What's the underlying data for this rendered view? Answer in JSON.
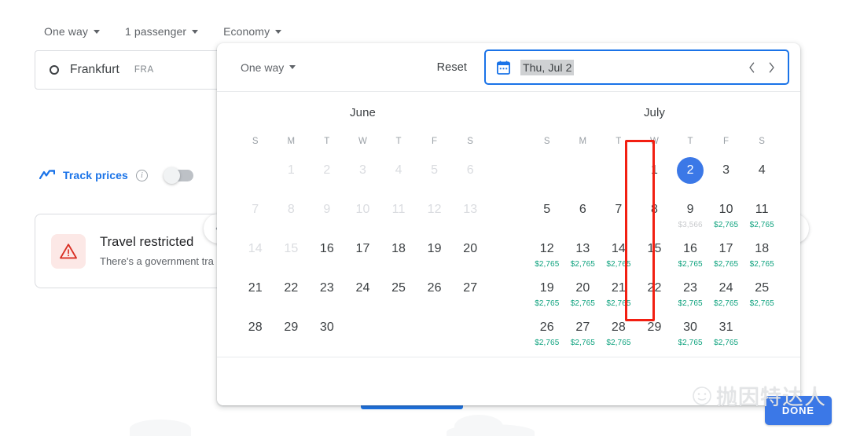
{
  "search_panel": {
    "options": [
      {
        "label": "One way",
        "icon": "chevron-down-icon"
      },
      {
        "label": "1 passenger",
        "icon": "chevron-down-icon"
      },
      {
        "label": "Economy",
        "icon": "chevron-down-icon"
      }
    ],
    "origin": {
      "city": "Frankfurt",
      "code": "FRA",
      "icon": "origin-ring-icon"
    },
    "track_prices": {
      "label": "Track prices",
      "info_icon": "info-icon",
      "toggle_state": "off"
    },
    "restriction_card": {
      "icon": "warning-triangle-icon",
      "title": "Travel restricted",
      "subtitle": "There's a government tra"
    }
  },
  "carousel": {
    "prev_icon": "chevron-left-icon",
    "next_icon": "chevron-right-icon"
  },
  "datepicker": {
    "trip_type": "One way",
    "trip_type_icon": "chevron-down-icon",
    "reset_label": "Reset",
    "date_field": {
      "icon": "calendar-icon",
      "value": "Thu, Jul 2",
      "prev_icon": "chevron-left-icon",
      "next_icon": "chevron-right-icon"
    },
    "done_label": "DONE",
    "dow": [
      "S",
      "M",
      "T",
      "W",
      "T",
      "F",
      "S"
    ],
    "months": [
      {
        "name": "June",
        "lead_blanks": 1,
        "days": [
          {
            "n": 1,
            "state": "disabled"
          },
          {
            "n": 2,
            "state": "disabled"
          },
          {
            "n": 3,
            "state": "disabled"
          },
          {
            "n": 4,
            "state": "disabled"
          },
          {
            "n": 5,
            "state": "disabled"
          },
          {
            "n": 6,
            "state": "disabled"
          },
          {
            "n": 7,
            "state": "disabled"
          },
          {
            "n": 8,
            "state": "disabled"
          },
          {
            "n": 9,
            "state": "disabled"
          },
          {
            "n": 10,
            "state": "disabled"
          },
          {
            "n": 11,
            "state": "disabled"
          },
          {
            "n": 12,
            "state": "disabled"
          },
          {
            "n": 13,
            "state": "disabled"
          },
          {
            "n": 14,
            "state": "disabled"
          },
          {
            "n": 15,
            "state": "disabled"
          },
          {
            "n": 16,
            "state": "enabled"
          },
          {
            "n": 17,
            "state": "enabled"
          },
          {
            "n": 18,
            "state": "enabled"
          },
          {
            "n": 19,
            "state": "enabled"
          },
          {
            "n": 20,
            "state": "enabled"
          },
          {
            "n": 21,
            "state": "enabled"
          },
          {
            "n": 22,
            "state": "enabled"
          },
          {
            "n": 23,
            "state": "enabled"
          },
          {
            "n": 24,
            "state": "enabled"
          },
          {
            "n": 25,
            "state": "enabled"
          },
          {
            "n": 26,
            "state": "enabled"
          },
          {
            "n": 27,
            "state": "enabled"
          },
          {
            "n": 28,
            "state": "enabled"
          },
          {
            "n": 29,
            "state": "enabled"
          },
          {
            "n": 30,
            "state": "enabled"
          }
        ]
      },
      {
        "name": "July",
        "lead_blanks": 3,
        "days": [
          {
            "n": 1,
            "state": "enabled",
            "price": ""
          },
          {
            "n": 2,
            "state": "selected",
            "price": ""
          },
          {
            "n": 3,
            "state": "enabled",
            "price": ""
          },
          {
            "n": 4,
            "state": "enabled",
            "price": ""
          },
          {
            "n": 5,
            "state": "enabled",
            "price": ""
          },
          {
            "n": 6,
            "state": "enabled",
            "price": ""
          },
          {
            "n": 7,
            "state": "enabled",
            "price": ""
          },
          {
            "n": 8,
            "state": "enabled",
            "price": ""
          },
          {
            "n": 9,
            "state": "enabled",
            "price": "$3,566",
            "price_level": "high"
          },
          {
            "n": 10,
            "state": "enabled",
            "price": "$2,765"
          },
          {
            "n": 11,
            "state": "enabled",
            "price": "$2,765"
          },
          {
            "n": 12,
            "state": "enabled",
            "price": "$2,765"
          },
          {
            "n": 13,
            "state": "enabled",
            "price": "$2,765"
          },
          {
            "n": 14,
            "state": "enabled",
            "price": "$2,765"
          },
          {
            "n": 15,
            "state": "enabled",
            "price": ""
          },
          {
            "n": 16,
            "state": "enabled",
            "price": "$2,765"
          },
          {
            "n": 17,
            "state": "enabled",
            "price": "$2,765"
          },
          {
            "n": 18,
            "state": "enabled",
            "price": "$2,765"
          },
          {
            "n": 19,
            "state": "enabled",
            "price": "$2,765"
          },
          {
            "n": 20,
            "state": "enabled",
            "price": "$2,765"
          },
          {
            "n": 21,
            "state": "enabled",
            "price": "$2,765"
          },
          {
            "n": 22,
            "state": "enabled",
            "price": ""
          },
          {
            "n": 23,
            "state": "enabled",
            "price": "$2,765"
          },
          {
            "n": 24,
            "state": "enabled",
            "price": "$2,765"
          },
          {
            "n": 25,
            "state": "enabled",
            "price": "$2,765"
          },
          {
            "n": 26,
            "state": "enabled",
            "price": "$2,765"
          },
          {
            "n": 27,
            "state": "enabled",
            "price": "$2,765"
          },
          {
            "n": 28,
            "state": "enabled",
            "price": "$2,765"
          },
          {
            "n": 29,
            "state": "enabled",
            "price": ""
          },
          {
            "n": 30,
            "state": "enabled",
            "price": "$2,765"
          },
          {
            "n": 31,
            "state": "enabled",
            "price": "$2,765"
          }
        ]
      }
    ],
    "annotation": {
      "shape": "rectangle",
      "color": "#f21f12",
      "target": "july-wednesday-column"
    }
  },
  "watermark": {
    "text": "抛因特达人",
    "icon": "smiley-face-icon"
  },
  "colors": {
    "accent_blue": "#1a73e8",
    "selected_day": "#3b78e7",
    "price_green": "#10a37f",
    "price_high": "#c8cacd",
    "annotation_red": "#f21f12",
    "warning_bg": "#fce8e6"
  }
}
